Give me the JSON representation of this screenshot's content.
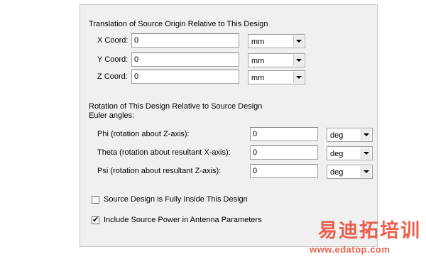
{
  "translation": {
    "heading": "Translation of Source Origin Relative to This Design",
    "rows": [
      {
        "label": "X Coord:",
        "value": "0",
        "unit": "mm"
      },
      {
        "label": "Y Coord:",
        "value": "0",
        "unit": "mm"
      },
      {
        "label": "Z Coord:",
        "value": "0",
        "unit": "mm"
      }
    ]
  },
  "rotation": {
    "heading": "Rotation of This Design Relative to Source Design",
    "subheading": "Euler angles:",
    "rows": [
      {
        "label": "Phi (rotation about Z-axis):",
        "value": "0",
        "unit": "deg"
      },
      {
        "label": "Theta (rotation about resultant X-axis):",
        "value": "0",
        "unit": "deg"
      },
      {
        "label": "Psi (rotation about resultant Z-axis):",
        "value": "0",
        "unit": "deg"
      }
    ]
  },
  "options": {
    "fully_inside": {
      "label": "Source Design is Fully Inside This Design",
      "checked": false
    },
    "include_power": {
      "label": "Include Source Power in Antenna Parameters",
      "checked": true
    }
  },
  "watermark": {
    "title": "易迪拓培训",
    "url": "www.edatop.com",
    "color": "#e8503c"
  }
}
